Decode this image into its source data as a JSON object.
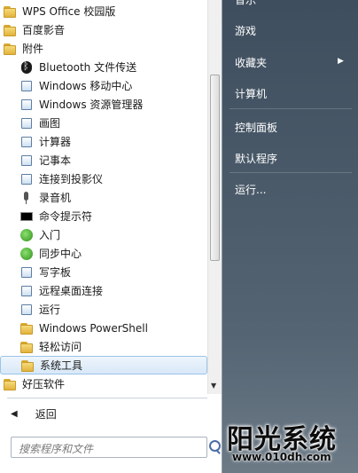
{
  "programs": [
    {
      "label": "WPS Office 校园版",
      "icon": "folder-icon",
      "level": 0
    },
    {
      "label": "百度影音",
      "icon": "folder-icon",
      "level": 0
    },
    {
      "label": "附件",
      "icon": "folder-open-icon",
      "level": 0
    },
    {
      "label": "Bluetooth 文件传送",
      "icon": "bluetooth-icon",
      "level": 1
    },
    {
      "label": "Windows 移动中心",
      "icon": "mobility-center-icon",
      "level": 1
    },
    {
      "label": "Windows 资源管理器",
      "icon": "explorer-icon",
      "level": 1
    },
    {
      "label": "画图",
      "icon": "paint-icon",
      "level": 1
    },
    {
      "label": "计算器",
      "icon": "calculator-icon",
      "level": 1
    },
    {
      "label": "记事本",
      "icon": "notepad-icon",
      "level": 1
    },
    {
      "label": "连接到投影仪",
      "icon": "projector-icon",
      "level": 1
    },
    {
      "label": "录音机",
      "icon": "microphone-icon",
      "level": 1
    },
    {
      "label": "命令提示符",
      "icon": "command-prompt-icon",
      "level": 1
    },
    {
      "label": "入门",
      "icon": "getting-started-icon",
      "level": 1
    },
    {
      "label": "同步中心",
      "icon": "sync-center-icon",
      "level": 1
    },
    {
      "label": "写字板",
      "icon": "wordpad-icon",
      "level": 1
    },
    {
      "label": "远程桌面连接",
      "icon": "remote-desktop-icon",
      "level": 1
    },
    {
      "label": "运行",
      "icon": "run-icon",
      "level": 1
    },
    {
      "label": "Windows PowerShell",
      "icon": "folder-icon",
      "level": 1
    },
    {
      "label": "轻松访问",
      "icon": "folder-icon",
      "level": 1
    },
    {
      "label": "系统工具",
      "icon": "folder-icon",
      "level": 1,
      "selected": true
    },
    {
      "label": "好压软件",
      "icon": "folder-icon",
      "level": 0
    }
  ],
  "back_label": "返回",
  "search": {
    "placeholder": "搜索程序和文件"
  },
  "right_menu": {
    "top_partial": "音乐",
    "games": "游戏",
    "favorites": "收藏夹",
    "computer": "计算机",
    "control_panel": "控制面板",
    "default_programs": "默认程序",
    "run": "运行..."
  },
  "watermark": {
    "title": "阳光系统",
    "url": "www.010dh.com"
  },
  "colors": {
    "selection": "#d8e8f8",
    "right_panel": "#4a5a69"
  }
}
